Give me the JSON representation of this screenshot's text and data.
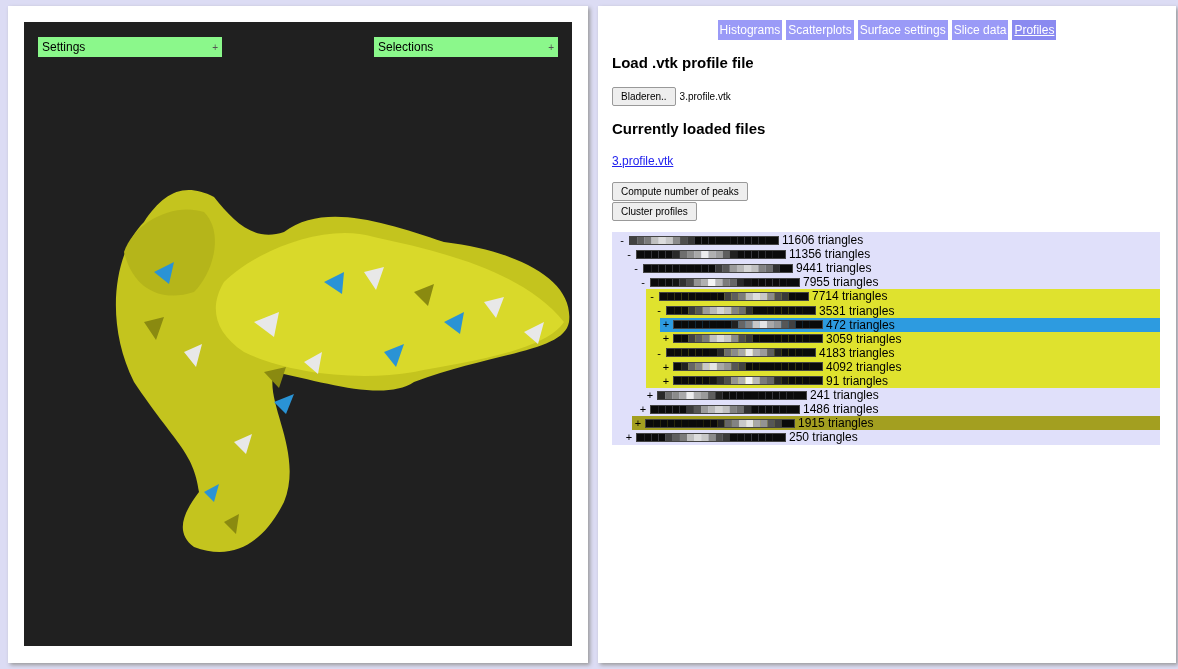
{
  "viewer": {
    "panels": [
      {
        "label": "Settings",
        "toggle": "+"
      },
      {
        "label": "Selections",
        "toggle": "+"
      }
    ]
  },
  "tabs": [
    {
      "label": "Histograms",
      "selected": false
    },
    {
      "label": "Scatterplots",
      "selected": false
    },
    {
      "label": "Surface settings",
      "selected": false
    },
    {
      "label": "Slice data",
      "selected": false
    },
    {
      "label": "Profiles",
      "selected": true
    }
  ],
  "load_heading": "Load .vtk profile file",
  "file_input": {
    "button": "Bladeren..",
    "value": "3.profile.vtk"
  },
  "loaded_heading": "Currently loaded files",
  "loaded_files": [
    "3.profile.vtk"
  ],
  "actions": [
    "Compute number of peaks",
    "Cluster profiles"
  ],
  "tree": [
    {
      "toggle": "-",
      "label": "11606 triangles",
      "selected": false,
      "children": [
        {
          "toggle": "-",
          "label": "11356 triangles",
          "selected": false,
          "children": [
            {
              "toggle": "-",
              "label": "9441 triangles",
              "selected": false,
              "children": [
                {
                  "toggle": "-",
                  "label": "7955 triangles",
                  "selected": false,
                  "children": [
                    {
                      "toggle": "-",
                      "label": "7714 triangles",
                      "selected": false,
                      "color": "#dfe22e",
                      "children": [
                        {
                          "toggle": "-",
                          "label": "3531 triangles",
                          "selected": false,
                          "children": [
                            {
                              "toggle": "+",
                              "label": "472 triangles",
                              "selected": true
                            },
                            {
                              "toggle": "+",
                              "label": "3059 triangles",
                              "selected": false
                            }
                          ]
                        },
                        {
                          "toggle": "-",
                          "label": "4183 triangles",
                          "selected": false,
                          "children": [
                            {
                              "toggle": "+",
                              "label": "4092 triangles",
                              "selected": false
                            },
                            {
                              "toggle": "+",
                              "label": "91 triangles",
                              "selected": false
                            }
                          ]
                        }
                      ]
                    },
                    {
                      "toggle": "+",
                      "label": "241 triangles",
                      "selected": false
                    }
                  ]
                },
                {
                  "toggle": "+",
                  "label": "1486 triangles",
                  "selected": false
                }
              ]
            },
            {
              "toggle": "+",
              "label": "1915 triangles",
              "selected": false,
              "color": "#a39f20"
            }
          ]
        },
        {
          "toggle": "+",
          "label": "250 triangles",
          "selected": false
        }
      ]
    }
  ]
}
